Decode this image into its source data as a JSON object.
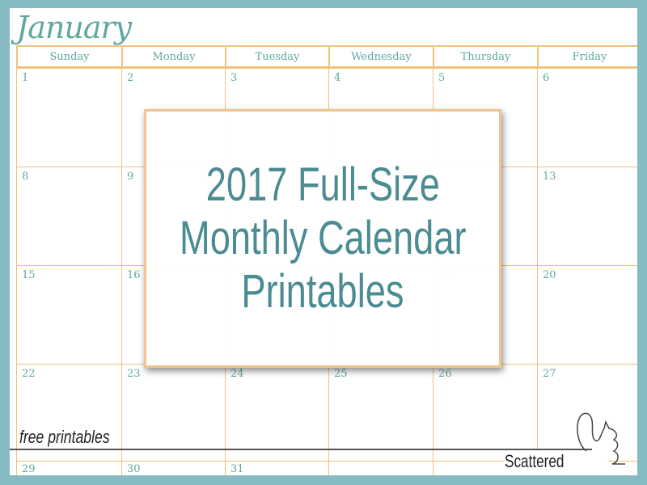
{
  "calendar": {
    "month": "January",
    "days": [
      "Sunday",
      "Monday",
      "Tuesday",
      "Wednesday",
      "Thursday",
      "Friday"
    ],
    "weeks": [
      [
        "1",
        "2",
        "3",
        "4",
        "5",
        "6"
      ],
      [
        "8",
        "9",
        "",
        "",
        "",
        "13"
      ],
      [
        "15",
        "16",
        "",
        "",
        "19",
        "20"
      ],
      [
        "22",
        "23",
        "24",
        "25",
        "26",
        "27"
      ],
      [
        "29",
        "30",
        "31",
        "",
        "",
        ""
      ]
    ]
  },
  "headline": {
    "line1": "2017 Full-Size",
    "line2": "Monthly Calendar",
    "line3": "Printables"
  },
  "footer": {
    "tagline": "free printables",
    "brand": "Scattered Squirrel"
  },
  "colors": {
    "frame": "#86bbc4",
    "grid": "#f1c27a",
    "text": "#4a8c92"
  }
}
